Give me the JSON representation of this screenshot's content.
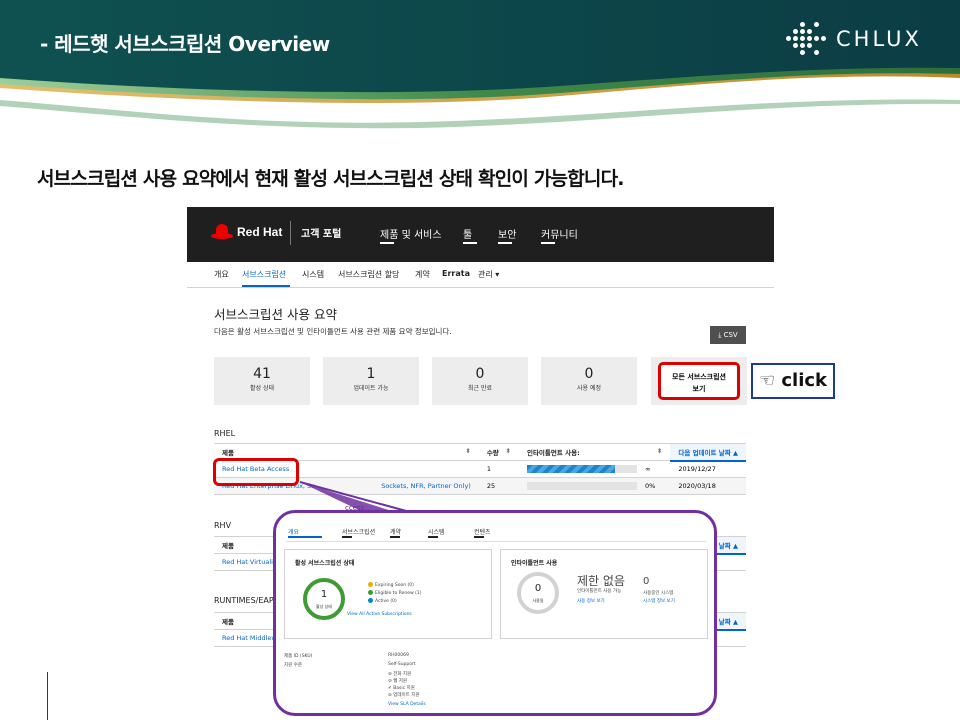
{
  "slide": {
    "title": "- 레드햇 서브스크립션 Overview",
    "logo_text": "CHLUX",
    "headline": "서브스크립션 사용 요약에서 현재 활성 서브스크립션 상태 확인이 가능합니다.",
    "click_label": "☜ click",
    "colors": {
      "banner_dark": "#0e4a4a",
      "banner_green": "#3f8a4a",
      "banner_gold": "#b78a2d",
      "highlight_red": "#dd0000",
      "popup_purple": "#7030a0",
      "callout_navy": "#1f3a93"
    }
  },
  "portal": {
    "brand": "Red Hat",
    "portal_name": "고객 포털",
    "top_nav": [
      "제품 및 서비스",
      "툴",
      "보안",
      "커뮤니티"
    ],
    "sub_nav": [
      "개요",
      "서브스크립션",
      "시스템",
      "서브스크립션 할당",
      "계약",
      "Errata",
      "관리 ▾"
    ],
    "active_sub_nav": "서브스크립션",
    "section_title": "서브스크립션 사용 요약",
    "section_desc": "다음은 활성 서브스크립션 및 인타이틀먼트 사용 관련 제품 요약 정보입니다.",
    "csv_label": "⤓ CSV",
    "stats": [
      {
        "value": "41",
        "label": "활성 상태"
      },
      {
        "value": "1",
        "label": "업데이트 가능"
      },
      {
        "value": "0",
        "label": "최근 만료"
      },
      {
        "value": "0",
        "label": "사용 예정"
      }
    ],
    "view_all_label_1": "모든 서브스크립션",
    "view_all_label_2": "보기",
    "rhel": {
      "title": "RHEL",
      "headers": [
        "제품",
        "수량",
        "인타이틀먼트 사용:",
        "다음 업데이트 날짜 ▲"
      ],
      "rows": [
        {
          "product": "Red Hat Beta Access",
          "qty": "1",
          "usage_fraction": 0.8,
          "usage_text": "∞",
          "date": "2019/12/27"
        },
        {
          "product": "Red Hat Enterprise Linux, Se",
          "product_tail": "Sockets, NFR, Partner Only)",
          "qty": "25",
          "usage_fraction": 0.0,
          "usage_text": "0%",
          "date": "2020/03/18"
        }
      ]
    },
    "rhv": {
      "title": "RHV",
      "header_product": "제품",
      "header_date": "날짜 ▲",
      "row_product": "Red Hat Virtualiza"
    },
    "runtimes": {
      "title": "RUNTIMES/EAP",
      "header_product": "제품",
      "header_date": "날짜 ▲",
      "row_product": "Red Hat Middlew"
    },
    "access_fragment": "ccess"
  },
  "popup": {
    "tabs": [
      "개요",
      "서브스크립션",
      "계약",
      "시스템",
      "컨텐츠"
    ],
    "status_card_title": "활성 서브스크립션 상태",
    "ring_value": "1",
    "ring_label": "활성 상태",
    "legend": [
      {
        "label": "Expiring Soon (0)",
        "color": "#f0ab00"
      },
      {
        "label": "Eligible to Renew (1)",
        "color": "#3f9c35"
      },
      {
        "label": "Active (0)",
        "color": "#0088ce"
      }
    ],
    "view_all_active": "View All Active Subscriptions",
    "usage_card_title": "인타이틀먼트 사용",
    "usage_ring_value": "0",
    "usage_ring_label": "사용됨",
    "unlimited_text": "제한 없음",
    "unlimited_sub": "인타이틀먼트 사용 가능",
    "used_systems_value": "0",
    "used_systems_label": "사용중인 시스템",
    "usage_info_link": "사용 정보 보기",
    "system_info_link": "시스템 정보 보기",
    "sku_label": "제품 ID (SKU)",
    "sku_value": "RH00069",
    "support_label": "지원 수준",
    "support_value": "Self-Support",
    "features": [
      "⊘ 전화 지원",
      "⊘ 웹 지원",
      "✔ Basic 지원",
      "⊘ 업데이트 지원"
    ],
    "sla_link": "View SLA Details"
  }
}
